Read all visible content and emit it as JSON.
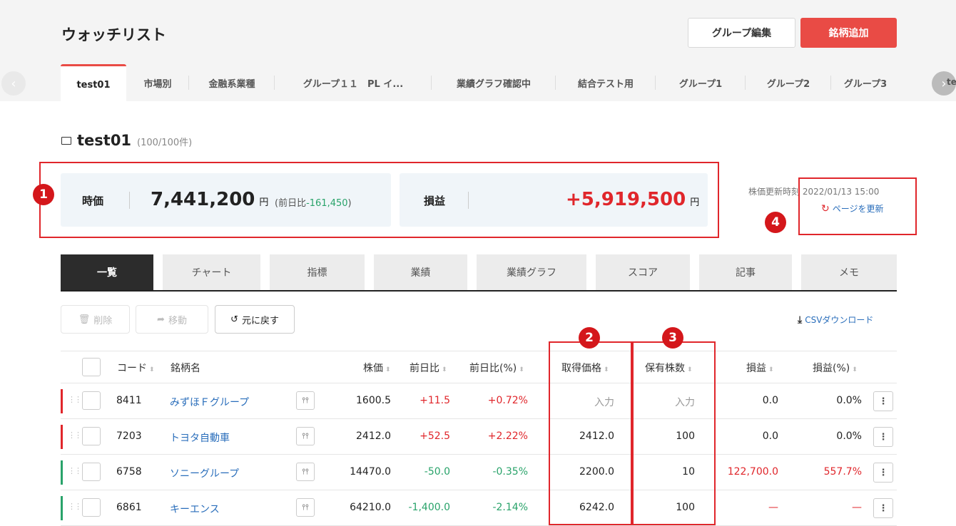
{
  "header": {
    "title": "ウォッチリスト",
    "group_edit_label": "グループ編集",
    "add_stock_label": "銘柄追加"
  },
  "group_tabs": [
    {
      "label": "test01",
      "active": true
    },
    {
      "label": "市場別"
    },
    {
      "label": "金融系業種"
    },
    {
      "label": "グループ１１　PL イ..."
    },
    {
      "label": "業績グラフ確認中"
    },
    {
      "label": "結合テスト用"
    },
    {
      "label": "グループ1"
    },
    {
      "label": "グループ2"
    },
    {
      "label": "グループ3"
    }
  ],
  "tab_cut_text": "te",
  "folder": {
    "name": "test01",
    "count": "(100/100件)"
  },
  "summary": {
    "price_label": "時価",
    "price_value": "7,441,200",
    "yen": "円",
    "diff_prefix": "(前日比",
    "diff_value": "-161,450",
    "diff_suffix": ")",
    "pl_label": "損益",
    "pl_value": "+5,919,500",
    "pl_yen": "円"
  },
  "update": {
    "time_text": "株価更新時刻 2022/01/13 15:00",
    "refresh_label": "ページを更新"
  },
  "annotations": [
    "1",
    "2",
    "3",
    "4"
  ],
  "view_tabs": [
    "一覧",
    "チャート",
    "指標",
    "業績",
    "業績グラフ",
    "スコア",
    "記事",
    "メモ"
  ],
  "toolbar": {
    "delete_label": "削除",
    "move_label": "移動",
    "undo_label": "元に戻す",
    "csv_label": "CSVダウンロード"
  },
  "table": {
    "headers": {
      "code": "コード",
      "name": "銘柄名",
      "price": "株価",
      "change": "前日比",
      "change_pct": "前日比(%)",
      "cost": "取得価格",
      "shares": "保有株数",
      "pl": "損益",
      "pl_pct": "損益(%)"
    },
    "rows": [
      {
        "code": "8411",
        "name": "みずほＦグループ",
        "price": "1600.5",
        "change": "+11.5",
        "change_pct": "+0.72%",
        "cost": "入力",
        "shares": "入力",
        "pl": "0.0",
        "pl_pct": "0.0%",
        "stripe": "#e0262b",
        "change_color": "#e0262b",
        "pl_color": "#222"
      },
      {
        "code": "7203",
        "name": "トヨタ自動車",
        "price": "2412.0",
        "change": "+52.5",
        "change_pct": "+2.22%",
        "cost": "2412.0",
        "shares": "100",
        "pl": "0.0",
        "pl_pct": "0.0%",
        "stripe": "#e0262b",
        "change_color": "#e0262b",
        "pl_color": "#222"
      },
      {
        "code": "6758",
        "name": "ソニーグループ",
        "price": "14470.0",
        "change": "-50.0",
        "change_pct": "-0.35%",
        "cost": "2200.0",
        "shares": "10",
        "pl": "122,700.0",
        "pl_pct": "557.7%",
        "stripe": "#29a36a",
        "change_color": "#29a36a",
        "pl_color": "#e0262b"
      },
      {
        "code": "6861",
        "name": "キーエンス",
        "price": "64210.0",
        "change": "-1,400.0",
        "change_pct": "-2.14%",
        "cost": "6242.0",
        "shares": "100",
        "pl": "—",
        "pl_pct": "—",
        "stripe": "#29a36a",
        "change_color": "#29a36a",
        "pl_color": "#e0262b"
      }
    ]
  }
}
